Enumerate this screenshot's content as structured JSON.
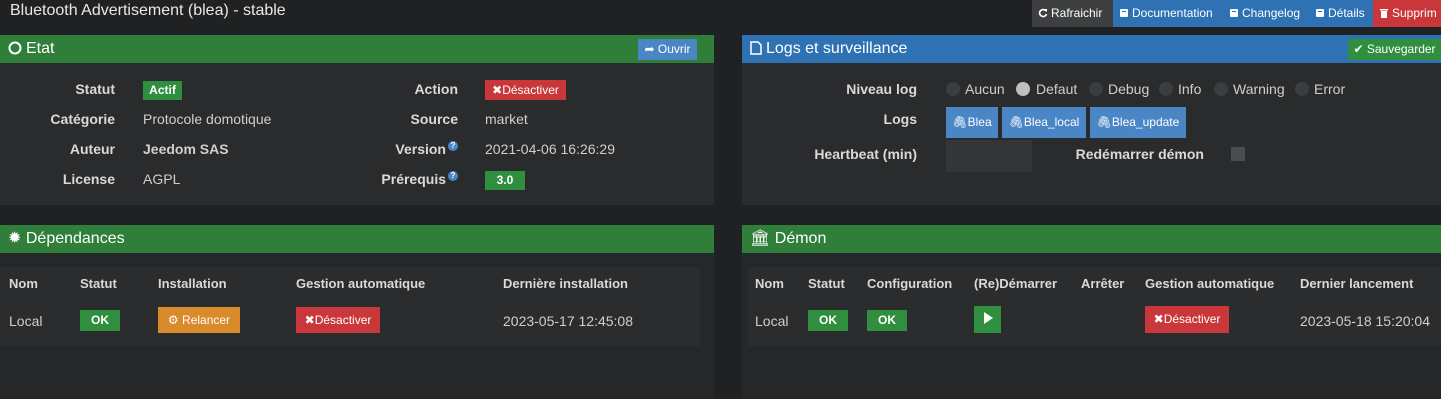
{
  "header": {
    "title": "Bluetooth Advertisement (blea) - stable",
    "buttons": {
      "refresh": "Rafraichir",
      "documentation": "Documentation",
      "changelog": "Changelog",
      "details": "Détails",
      "delete": "Supprim"
    }
  },
  "etat": {
    "title": "Etat",
    "open_button": "Ouvrir",
    "statut_label": "Statut",
    "statut_value": "Actif",
    "action_label": "Action",
    "action_button": "Désactiver",
    "categorie_label": "Catégorie",
    "categorie_value": "Protocole domotique",
    "source_label": "Source",
    "source_value": "market",
    "auteur_label": "Auteur",
    "auteur_value": "Jeedom SAS",
    "version_label": "Version",
    "version_value": "2021-04-06 16:26:29",
    "license_label": "License",
    "license_value": "AGPL",
    "prerequis_label": "Prérequis",
    "prerequis_value": "3.0"
  },
  "logs": {
    "title": "Logs et surveillance",
    "save_button": "Sauvegarder",
    "niveau_label": "Niveau log",
    "levels": [
      "Aucun",
      "Defaut",
      "Debug",
      "Info",
      "Warning",
      "Error"
    ],
    "selected_level": "Defaut",
    "logs_label": "Logs",
    "log_buttons": [
      "Blea",
      "Blea_local",
      "Blea_update"
    ],
    "heartbeat_label": "Heartbeat (min)",
    "heartbeat_value": "",
    "restart_label": "Redémarrer démon",
    "restart_checked": false
  },
  "dependances": {
    "title": "Dépendances",
    "headers": [
      "Nom",
      "Statut",
      "Installation",
      "Gestion automatique",
      "Dernière installation"
    ],
    "row": {
      "nom": "Local",
      "statut": "OK",
      "installation": "Relancer",
      "gestion": "Désactiver",
      "derniere": "2023-05-17 12:45:08"
    }
  },
  "demon": {
    "title": "Démon",
    "headers": [
      "Nom",
      "Statut",
      "Configuration",
      "(Re)Démarrer",
      "Arrêter",
      "Gestion automatique",
      "Dernier lancement"
    ],
    "row": {
      "nom": "Local",
      "statut": "OK",
      "configuration": "OK",
      "gestion": "Désactiver",
      "dernier": "2023-05-18 15:20:04"
    }
  },
  "colors": {
    "green_header": "#2f7f3a",
    "blue_header": "#2e72b3",
    "badge_green": "#2f8f3e",
    "badge_red": "#c9373a",
    "badge_orange": "#d98a2b",
    "badge_blue": "#4a86c5"
  }
}
